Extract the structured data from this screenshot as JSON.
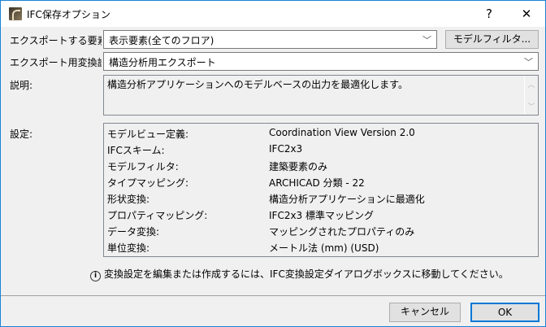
{
  "window": {
    "title": "IFC保存オプション",
    "help": "?",
    "close": "✕"
  },
  "export_elements": {
    "label": "エクスポートする要素:",
    "value": "表示要素(全てのフロア)",
    "filter_button": "モデルフィルタ..."
  },
  "translator": {
    "label": "エクスポート用変換設定",
    "value": "構造分析用エクスポート"
  },
  "description": {
    "label": "説明:",
    "text": "構造分析アプリケーションへのモデルベースの出力を最適化します。"
  },
  "settings": {
    "label": "設定:",
    "rows": [
      {
        "key": "モデルビュー定義:",
        "value": "Coordination View Version 2.0"
      },
      {
        "key": "IFCスキーム:",
        "value": "IFC2x3"
      },
      {
        "key": "モデルフィルタ:",
        "value": "建築要素のみ"
      },
      {
        "key": "タイプマッピング:",
        "value": "ARCHICAD 分類 - 22"
      },
      {
        "key": "形状変換:",
        "value": "構造分析アプリケーションに最適化"
      },
      {
        "key": "プロパティマッピング:",
        "value": "IFC2x3 標準マッピング"
      },
      {
        "key": "データ変換:",
        "value": "マッピングされたプロパティのみ"
      },
      {
        "key": "単位変換:",
        "value": "メートル法 (mm) (USD)"
      }
    ]
  },
  "info": {
    "icon": "i",
    "text": "変換設定を編集または作成するには、IFC変換設定ダイアログボックスに移動してください。"
  },
  "buttons": {
    "cancel": "キャンセル",
    "ok": "OK"
  }
}
